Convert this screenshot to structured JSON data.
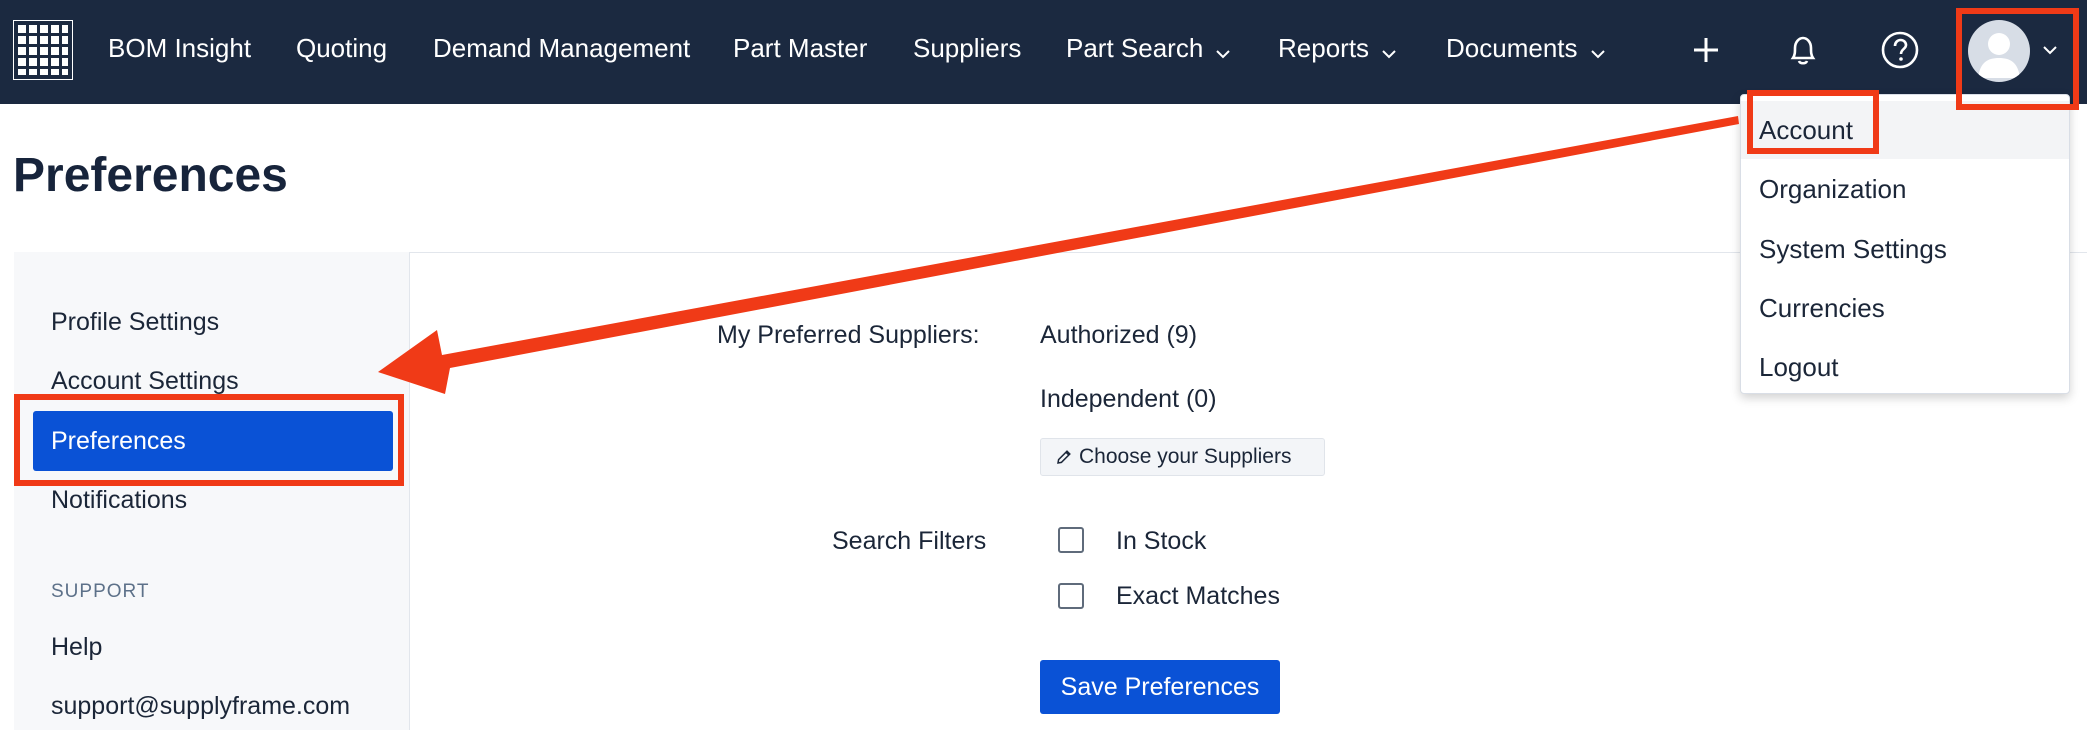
{
  "header": {
    "logo_icon": "grid-logo-icon",
    "nav": [
      {
        "label": "BOM Insight"
      },
      {
        "label": "Quoting"
      },
      {
        "label": "Demand Management"
      },
      {
        "label": "Part Master"
      },
      {
        "label": "Suppliers"
      },
      {
        "label": "Part Search",
        "icon": "chevron-down-icon"
      },
      {
        "label": "Reports",
        "icon": "chevron-down-icon"
      },
      {
        "label": "Documents",
        "icon": "chevron-down-icon"
      }
    ],
    "icons": [
      "plus-icon",
      "bell-icon",
      "help-icon",
      "avatar-icon",
      "chevron-down-icon"
    ]
  },
  "account_menu": {
    "items": [
      {
        "label": "Account",
        "active": true
      },
      {
        "label": "Organization"
      },
      {
        "label": "System Settings"
      },
      {
        "label": "Currencies"
      },
      {
        "label": "Logout"
      }
    ]
  },
  "page": {
    "title": "Preferences"
  },
  "sidebar": {
    "items": [
      {
        "label": "Profile Settings"
      },
      {
        "label": "Account Settings"
      },
      {
        "label": "Preferences",
        "active": true
      },
      {
        "label": "Notifications"
      }
    ],
    "support_heading": "SUPPORT",
    "support_items": [
      {
        "label": "Help"
      },
      {
        "label": "support@supplyframe.com"
      }
    ]
  },
  "preferences": {
    "suppliers_label": "My Preferred Suppliers:",
    "authorized": "Authorized (9)",
    "independent": "Independent (0)",
    "choose_button": "Choose your Suppliers",
    "choose_icon": "pencil-icon",
    "filters_label": "Search Filters",
    "filters": [
      {
        "label": "In Stock",
        "checked": false
      },
      {
        "label": "Exact Matches",
        "checked": false
      }
    ],
    "save_button": "Save Preferences"
  },
  "colors": {
    "nav_bg": "#1b2940",
    "accent": "#0a52d6",
    "annotation": "#f03a17"
  }
}
